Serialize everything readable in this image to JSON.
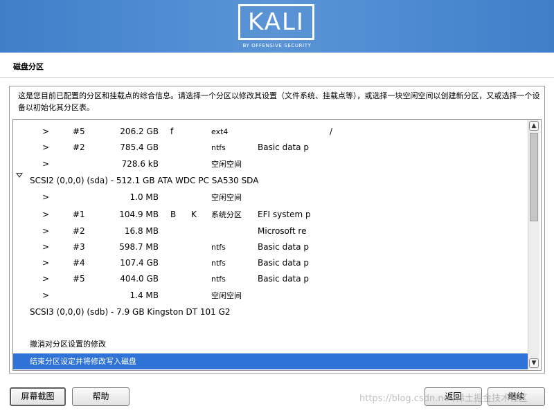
{
  "header": {
    "logo_text": "KALI",
    "logo_subtext": "BY OFFENSIVE SECURITY"
  },
  "page_title": "磁盘分区",
  "description": "这是您目前已配置的分区和挂载点的综合信息。请选择一个分区以修改其设置（文件系统、挂载点等），或选择一块空闲空间以创建新分区，又或选择一个设备以初始化其分区表。",
  "rows": [
    {
      "arrow": ">",
      "num": "#5",
      "size": "206.2 GB",
      "f1": "f",
      "f2": "",
      "fs": "ext4",
      "name": "",
      "mount": "/"
    },
    {
      "arrow": ">",
      "num": "#2",
      "size": "785.4 GB",
      "f1": "",
      "f2": "",
      "fs": "ntfs",
      "name": "Basic data p",
      "mount": ""
    },
    {
      "arrow": ">",
      "num": "",
      "size": "728.6 kB",
      "f1": "",
      "f2": "",
      "fs": "空闲空间",
      "name": "",
      "mount": ""
    },
    {
      "disk": "SCSI2 (0,0,0) (sda) - 512.1 GB ATA WDC PC SA530 SDA",
      "expanded": true
    },
    {
      "arrow": ">",
      "num": "",
      "size": "1.0 MB",
      "f1": "",
      "f2": "",
      "fs": "空闲空间",
      "name": "",
      "mount": ""
    },
    {
      "arrow": ">",
      "num": "#1",
      "size": "104.9 MB",
      "f1": "B",
      "f2": "K",
      "fs": "系统分区",
      "name": "EFI system p",
      "mount": ""
    },
    {
      "arrow": ">",
      "num": "#2",
      "size": "16.8 MB",
      "f1": "",
      "f2": "",
      "fs": "",
      "name": "Microsoft re",
      "mount": ""
    },
    {
      "arrow": ">",
      "num": "#3",
      "size": "598.7 MB",
      "f1": "",
      "f2": "",
      "fs": "ntfs",
      "name": "Basic data p",
      "mount": ""
    },
    {
      "arrow": ">",
      "num": "#4",
      "size": "107.4 GB",
      "f1": "",
      "f2": "",
      "fs": "ntfs",
      "name": "Basic data p",
      "mount": ""
    },
    {
      "arrow": ">",
      "num": "#5",
      "size": "404.0 GB",
      "f1": "",
      "f2": "",
      "fs": "ntfs",
      "name": "Basic data p",
      "mount": ""
    },
    {
      "arrow": ">",
      "num": "",
      "size": "1.4 MB",
      "f1": "",
      "f2": "",
      "fs": "空闲空间",
      "name": "",
      "mount": ""
    },
    {
      "disk": "SCSI3 (0,0,0) (sdb) - 7.9 GB Kingston DT 101 G2",
      "expanded": false
    }
  ],
  "actions": {
    "undo": "撤消对分区设置的修改",
    "finish": "结束分区设定并将修改写入磁盘"
  },
  "buttons": {
    "screenshot": "屏幕截图",
    "help": "帮助",
    "back": "返回",
    "continue": "继续"
  },
  "watermark": "https://blog.csdn.net/稀土掘金技术社区",
  "colors": {
    "header_blue": "#4a86cf",
    "selection_blue": "#2f73d8"
  }
}
